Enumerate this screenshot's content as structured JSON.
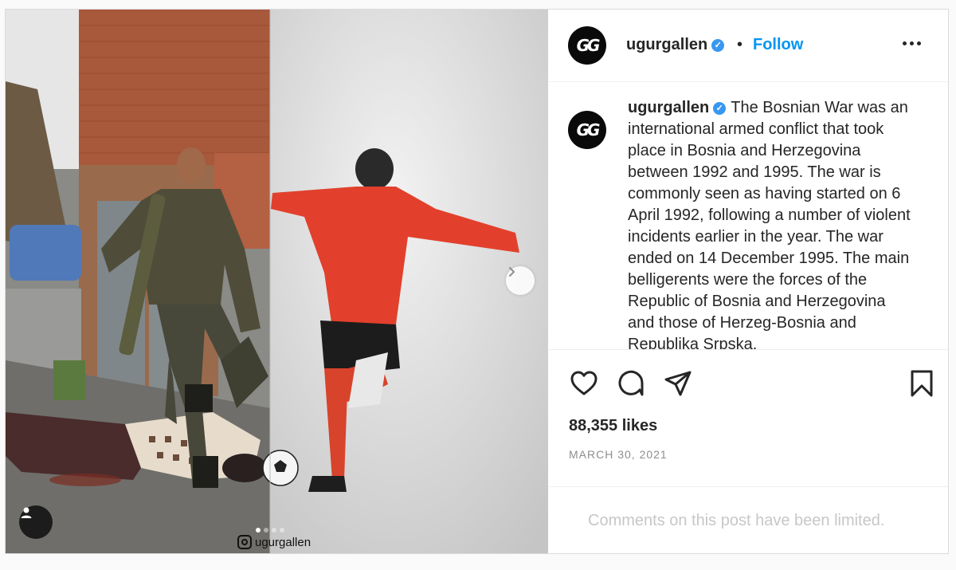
{
  "post": {
    "username": "ugurgallen",
    "avatar_initials": "GG",
    "follow_label": "Follow",
    "separator": "•",
    "verified_mark": "✓",
    "caption_text": "The Bosnian War was an international armed conflict that took place in Bosnia and Herzegovina between 1992 and 1995. The war is commonly seen as having started on 6 April 1992, following a number of violent incidents earlier in the year. The war ended on 14 December 1995. The main belligerents were the forces of the Republic of Bosnia and Herzegovina and those of Herzeg-Bosnia and Republika Srpska.",
    "likes": "88,355 likes",
    "date": "MARCH 30, 2021",
    "comments_notice": "Comments on this post have been limited."
  },
  "media": {
    "watermark": "ugurgallen",
    "carousel_index": 1,
    "carousel_count": 4
  },
  "icons": {
    "like": "heart-icon",
    "comment": "comment-bubble-icon",
    "share": "paper-plane-icon",
    "save": "bookmark-icon",
    "more": "more-horizontal-icon",
    "next": "chevron-right-icon",
    "tag": "user-tag-icon"
  },
  "colors": {
    "follow": "#0095f6",
    "verified": "#3897f0",
    "muted": "#8e8e8e",
    "jersey": "#e2402c"
  }
}
